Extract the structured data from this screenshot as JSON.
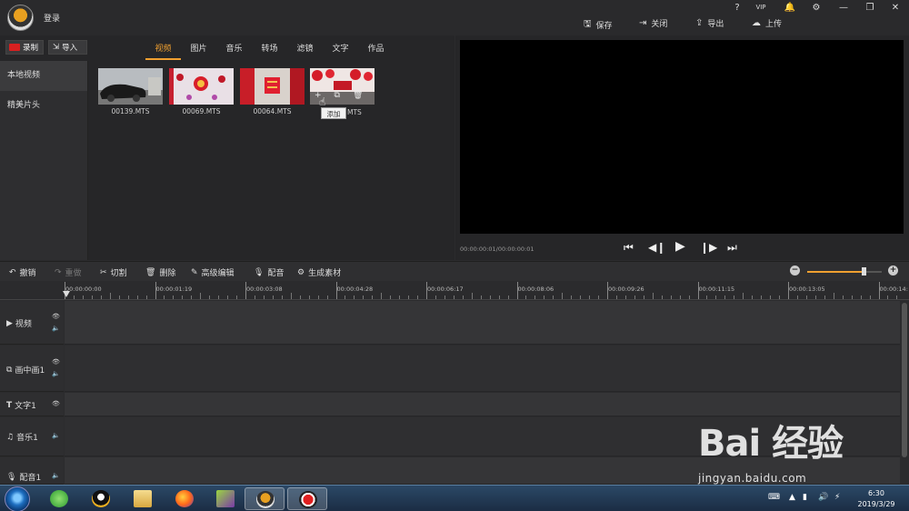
{
  "titlebar": {
    "login_label": "登录",
    "controls": [
      "?",
      "VIP",
      "🔔",
      "⚙",
      "—",
      "❐",
      "✕"
    ],
    "actions": [
      {
        "label": "保存",
        "icon": "save-icon"
      },
      {
        "label": "关闭",
        "icon": "close-project-icon"
      },
      {
        "label": "导出",
        "icon": "export-icon"
      },
      {
        "label": "上传",
        "icon": "upload-cloud-icon"
      }
    ]
  },
  "library": {
    "record_label": "录制",
    "import_label": "导入",
    "tabs": [
      "视频",
      "图片",
      "音乐",
      "转场",
      "滤镜",
      "文字",
      "作品"
    ],
    "active_tab": 0,
    "sidebar": [
      "本地视频",
      "精美片头"
    ],
    "clips": [
      "00139.MTS",
      "00069.MTS",
      "00064.MTS",
      "MTS"
    ],
    "tooltip": "添加"
  },
  "preview": {
    "timecode": "00:00:00:01/00:00:00:01"
  },
  "toolbar": {
    "undo": "撤销",
    "redo": "重做",
    "cut": "切割",
    "delete": "删除",
    "advanced_edit": "高级编辑",
    "dub": "配音",
    "generate": "生成素材",
    "zoom_level": 0.75
  },
  "ruler": {
    "labels": [
      "00:00:00:00",
      "00:00:01:19",
      "00:00:03:08",
      "00:00:04:28",
      "00:00:06:17",
      "00:00:08:06",
      "00:00:09:26",
      "00:00:11:15",
      "00:00:13:05",
      "00:00:14:"
    ]
  },
  "tracks": {
    "video": "视频",
    "pip": "画中画1",
    "text": "文字1",
    "music": "音乐1",
    "dub": "配音1"
  },
  "taskbar": {
    "time": "6:30",
    "date": "2019/3/29"
  },
  "watermark": {
    "brand": "Bai 经验",
    "url": "jingyan.baidu.com"
  }
}
